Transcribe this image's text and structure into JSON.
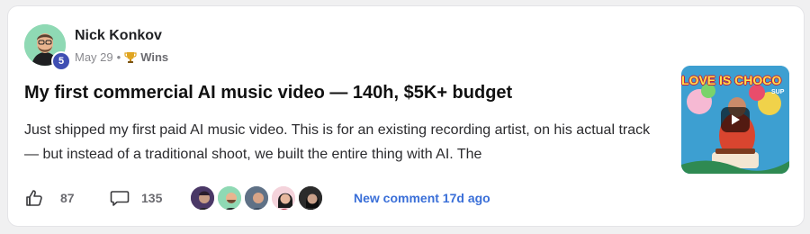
{
  "post": {
    "author": "Nick Konkov",
    "level": "5",
    "date": "May 29",
    "separator": "•",
    "category_icon": "trophy-icon",
    "category": "Wins",
    "title": "My first commercial AI music video — 140h, $5K+ budget",
    "excerpt": "Just shipped my first paid AI music video. This is for an existing recording artist, on his actual track — but instead of a traditional shoot, we built the entire thing with AI. The",
    "thumbnail": {
      "overlay_text": "LOVE IS CHOCO",
      "overlay_subtext": "SUP",
      "play_icon": "play-icon"
    }
  },
  "footer": {
    "like_icon": "thumbs-up-icon",
    "likes": "87",
    "comment_icon": "comment-icon",
    "comments": "135",
    "commenter_avatar_count": 5,
    "new_comment": "New comment 17d ago"
  },
  "colors": {
    "card_bg": "#ffffff",
    "page_bg": "#f0f0f1",
    "level_badge": "#3f4fb3",
    "link_blue": "#3a6fd8",
    "avatar_bg": "#8fd9b4"
  }
}
